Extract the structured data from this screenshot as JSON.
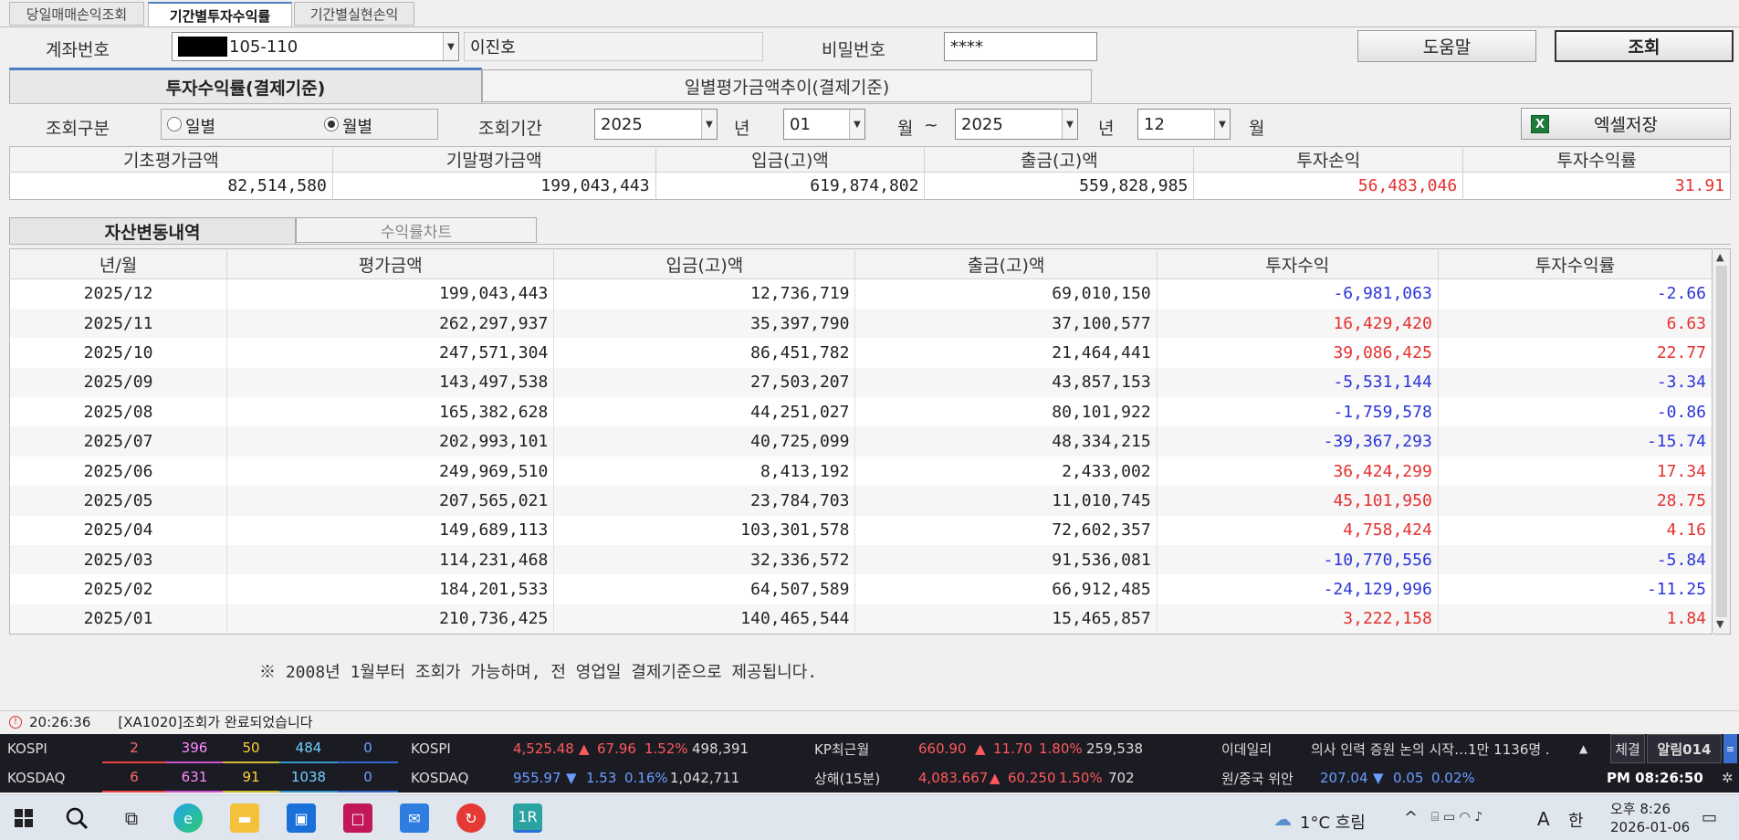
{
  "top_tabs": [
    "당일매매손익조회",
    "기간별투자수익률",
    "기간별실현손익"
  ],
  "account": {
    "label": "계좌번호",
    "number": "105-110",
    "name": "이진호",
    "password_label": "비밀번호",
    "password_value": "****"
  },
  "buttons": {
    "help": "도움말",
    "query": "조회",
    "excel": "엑셀저장"
  },
  "view_tabs": [
    "투자수익률(결제기준)",
    "일별평가금액추이(결제기준)"
  ],
  "query": {
    "type_label": "조회구분",
    "daily": "일별",
    "monthly": "월별",
    "selected": "월별",
    "period_label": "조회기간",
    "from_year": "2025",
    "year_unit": "년",
    "from_month": "01",
    "month_unit": "월",
    "tilde": "~",
    "to_year": "2025",
    "to_month": "12"
  },
  "summary": {
    "headers": [
      "기초평가금액",
      "기말평가금액",
      "입금(고)액",
      "출금(고)액",
      "투자손익",
      "투자수익률"
    ],
    "values": [
      "82,514,580",
      "199,043,443",
      "619,874,802",
      "559,828,985",
      "56,483,046",
      "31.91"
    ]
  },
  "sub_tabs": [
    "자산변동내역",
    "수익률차트"
  ],
  "grid": {
    "headers": [
      "년/월",
      "평가금액",
      "입금(고)액",
      "출금(고)액",
      "투자수익",
      "투자수익률"
    ],
    "rows": [
      [
        "2025/12",
        "199,043,443",
        "12,736,719",
        "69,010,150",
        "-6,981,063",
        "-2.66"
      ],
      [
        "2025/11",
        "262,297,937",
        "35,397,790",
        "37,100,577",
        "16,429,420",
        "6.63"
      ],
      [
        "2025/10",
        "247,571,304",
        "86,451,782",
        "21,464,441",
        "39,086,425",
        "22.77"
      ],
      [
        "2025/09",
        "143,497,538",
        "27,503,207",
        "43,857,153",
        "-5,531,144",
        "-3.34"
      ],
      [
        "2025/08",
        "165,382,628",
        "44,251,027",
        "80,101,922",
        "-1,759,578",
        "-0.86"
      ],
      [
        "2025/07",
        "202,993,101",
        "40,725,099",
        "48,334,215",
        "-39,367,293",
        "-15.74"
      ],
      [
        "2025/06",
        "249,969,510",
        "8,413,192",
        "2,433,002",
        "36,424,299",
        "17.34"
      ],
      [
        "2025/05",
        "207,565,021",
        "23,784,703",
        "11,010,745",
        "45,101,950",
        "28.75"
      ],
      [
        "2025/04",
        "149,689,113",
        "103,301,578",
        "72,602,357",
        "4,758,424",
        "4.16"
      ],
      [
        "2025/03",
        "114,231,468",
        "32,336,572",
        "91,536,081",
        "-10,770,556",
        "-5.84"
      ],
      [
        "2025/02",
        "184,201,533",
        "64,507,589",
        "66,912,485",
        "-24,129,996",
        "-11.25"
      ],
      [
        "2025/01",
        "210,736,425",
        "140,465,544",
        "15,465,857",
        "3,222,158",
        "1.84"
      ]
    ]
  },
  "notice": "※ 2008년 1월부터 조회가 가능하며, 전 영업일 결제기준으로 제공됩니다.",
  "status": {
    "time": "20:26:36",
    "message": "[XA1020]조회가 완료되었습니다"
  },
  "ticker": {
    "row1": {
      "index": "KOSPI",
      "counts": [
        "2",
        "396",
        "50",
        "484",
        "0"
      ],
      "name2": "KOSPI",
      "value": "4,525.48",
      "dir": "▲",
      "change": "67.96",
      "pct": "1.52%",
      "volume": "498,391",
      "name3": "KP최근월",
      "value3": "660.90",
      "dir3": "▲",
      "change3": "11.70",
      "pct3": "1.80%",
      "vol3": "259,538",
      "news_src": "이데일리",
      "news": "의사 인력 증원 논의 시작…1만 1136명 .",
      "tab1": "체결",
      "tab2": "알림014"
    },
    "row2": {
      "index": "KOSDAQ",
      "counts": [
        "6",
        "631",
        "91",
        "1038",
        "0"
      ],
      "name2": "KOSDAQ",
      "value": "955.97",
      "dir": "▼",
      "change": "1.53",
      "pct": "0.16%",
      "volume": "1,042,711",
      "name3": "상해(15분)",
      "value3": "4,083.667",
      "dir3": "▲",
      "change3": "60.250",
      "pct3": "1.50%",
      "vol3": "702",
      "fx_label": "원/중국 위안",
      "fx_value": "207.04",
      "fx_dir": "▼",
      "fx_change": "0.05",
      "fx_pct": "0.02%",
      "clock": "PM 08:26:50"
    }
  },
  "taskbar": {
    "weather": "1°C 흐림",
    "ime_a": "A",
    "ime_han": "한",
    "time": "오후 8:26",
    "date": "2026-01-06"
  }
}
